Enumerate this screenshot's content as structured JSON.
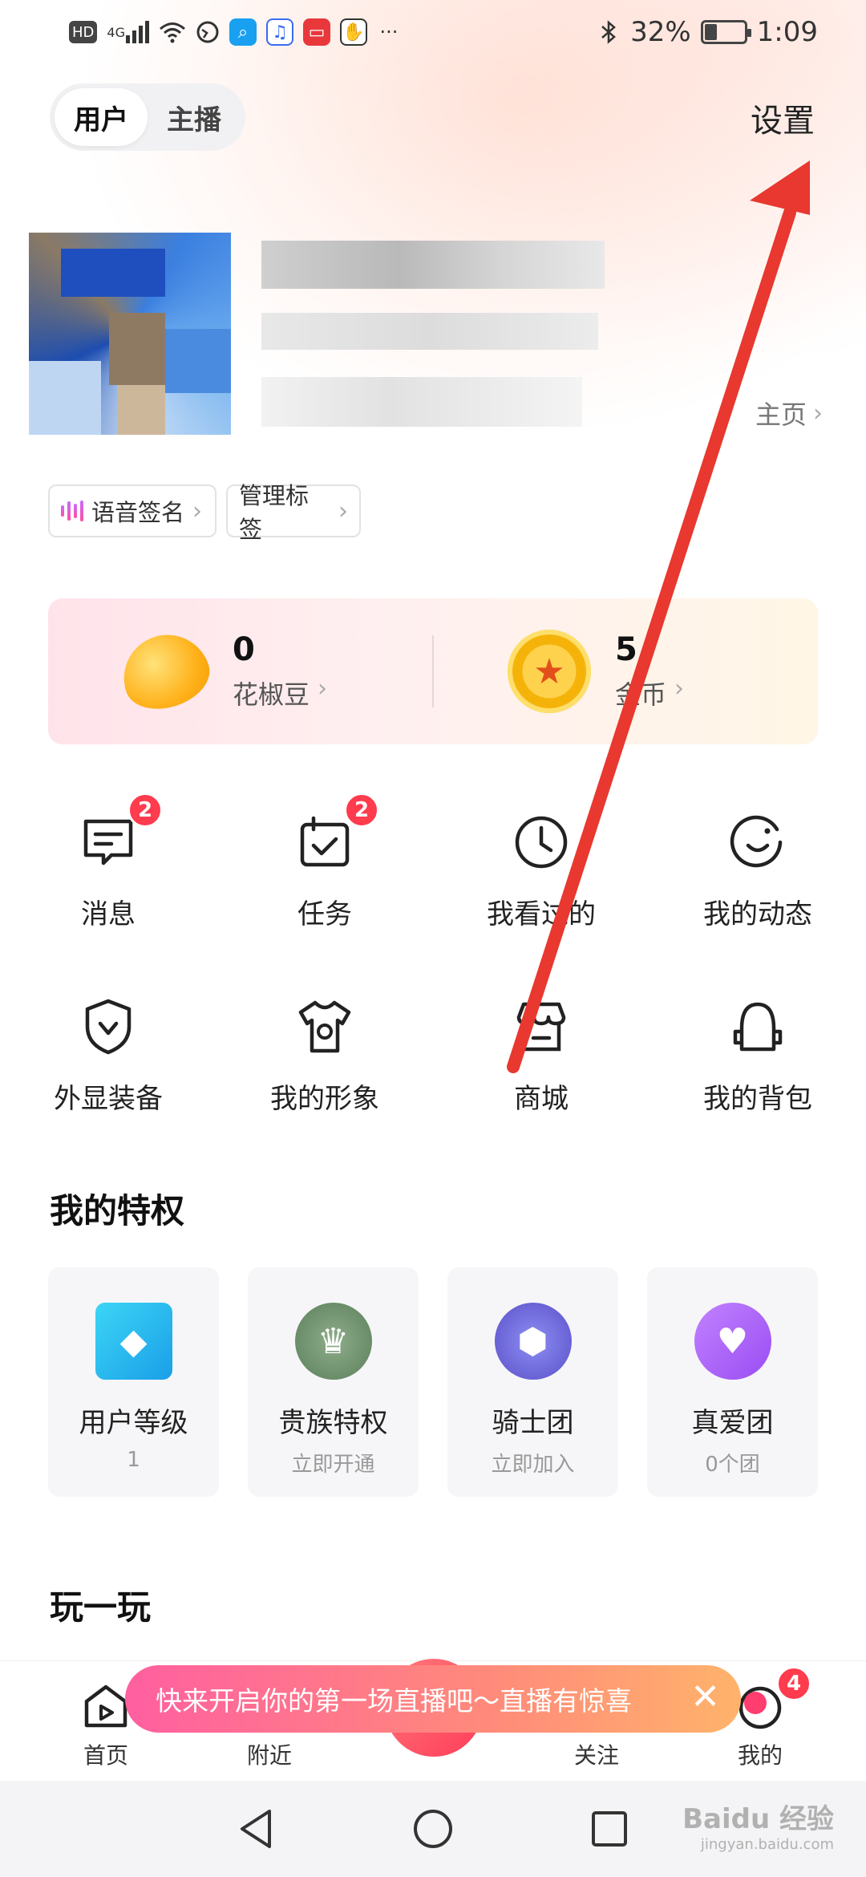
{
  "status_bar": {
    "left_icons": [
      "hd-icon",
      "signal-4g-icon",
      "wifi-icon",
      "vpn-icon",
      "search-app-icon",
      "music-app-icon",
      "book-app-icon",
      "hand-app-icon",
      "more-icon"
    ],
    "hd": "HD",
    "net": "4G",
    "battery": "32%",
    "battery_level": 0.32,
    "time": "1:09"
  },
  "header": {
    "role_user": "用户",
    "role_host": "主播",
    "settings": "设置"
  },
  "profile": {
    "homepage_link": "主页",
    "tags": {
      "voice_signature": "语音签名",
      "manage_tags": "管理标签"
    }
  },
  "wallet": {
    "beans_value": "0",
    "beans_label": "花椒豆",
    "coins_value": "5",
    "coins_label": "金币"
  },
  "menu_row1": [
    {
      "label": "消息",
      "icon": "message-icon",
      "badge": "2"
    },
    {
      "label": "任务",
      "icon": "task-icon",
      "badge": "2"
    },
    {
      "label": "我看过的",
      "icon": "history-clock-icon",
      "badge": ""
    },
    {
      "label": "我的动态",
      "icon": "moments-icon",
      "badge": ""
    }
  ],
  "menu_row2": [
    {
      "label": "外显装备",
      "icon": "shield-icon"
    },
    {
      "label": "我的形象",
      "icon": "tshirt-icon"
    },
    {
      "label": "商城",
      "icon": "store-icon"
    },
    {
      "label": "我的背包",
      "icon": "backpack-icon"
    }
  ],
  "privileges": {
    "title": "我的特权",
    "cards": [
      {
        "title": "用户等级",
        "sub": "1",
        "icon": "diamond-icon"
      },
      {
        "title": "贵族特权",
        "sub": "立即开通",
        "icon": "noble-crest-icon"
      },
      {
        "title": "骑士团",
        "sub": "立即加入",
        "icon": "knight-badge-icon"
      },
      {
        "title": "真爱团",
        "sub": "0个团",
        "icon": "heart-group-icon"
      }
    ]
  },
  "play_section": {
    "title": "玩一玩"
  },
  "promo": {
    "text": "快来开启你的第一场直播吧～直播有惊喜"
  },
  "tabbar": {
    "home": "首页",
    "nearby": "附近",
    "follow": "关注",
    "mine": "我的",
    "mine_badge": "4"
  },
  "watermark": {
    "brand": "Baidu 经验",
    "url": "jingyan.baidu.com"
  },
  "colors": {
    "accent_red": "#ff3b4e",
    "annotation_arrow": "#e8382f",
    "promo_start": "#ff5fa0",
    "promo_end": "#ffb36b"
  }
}
